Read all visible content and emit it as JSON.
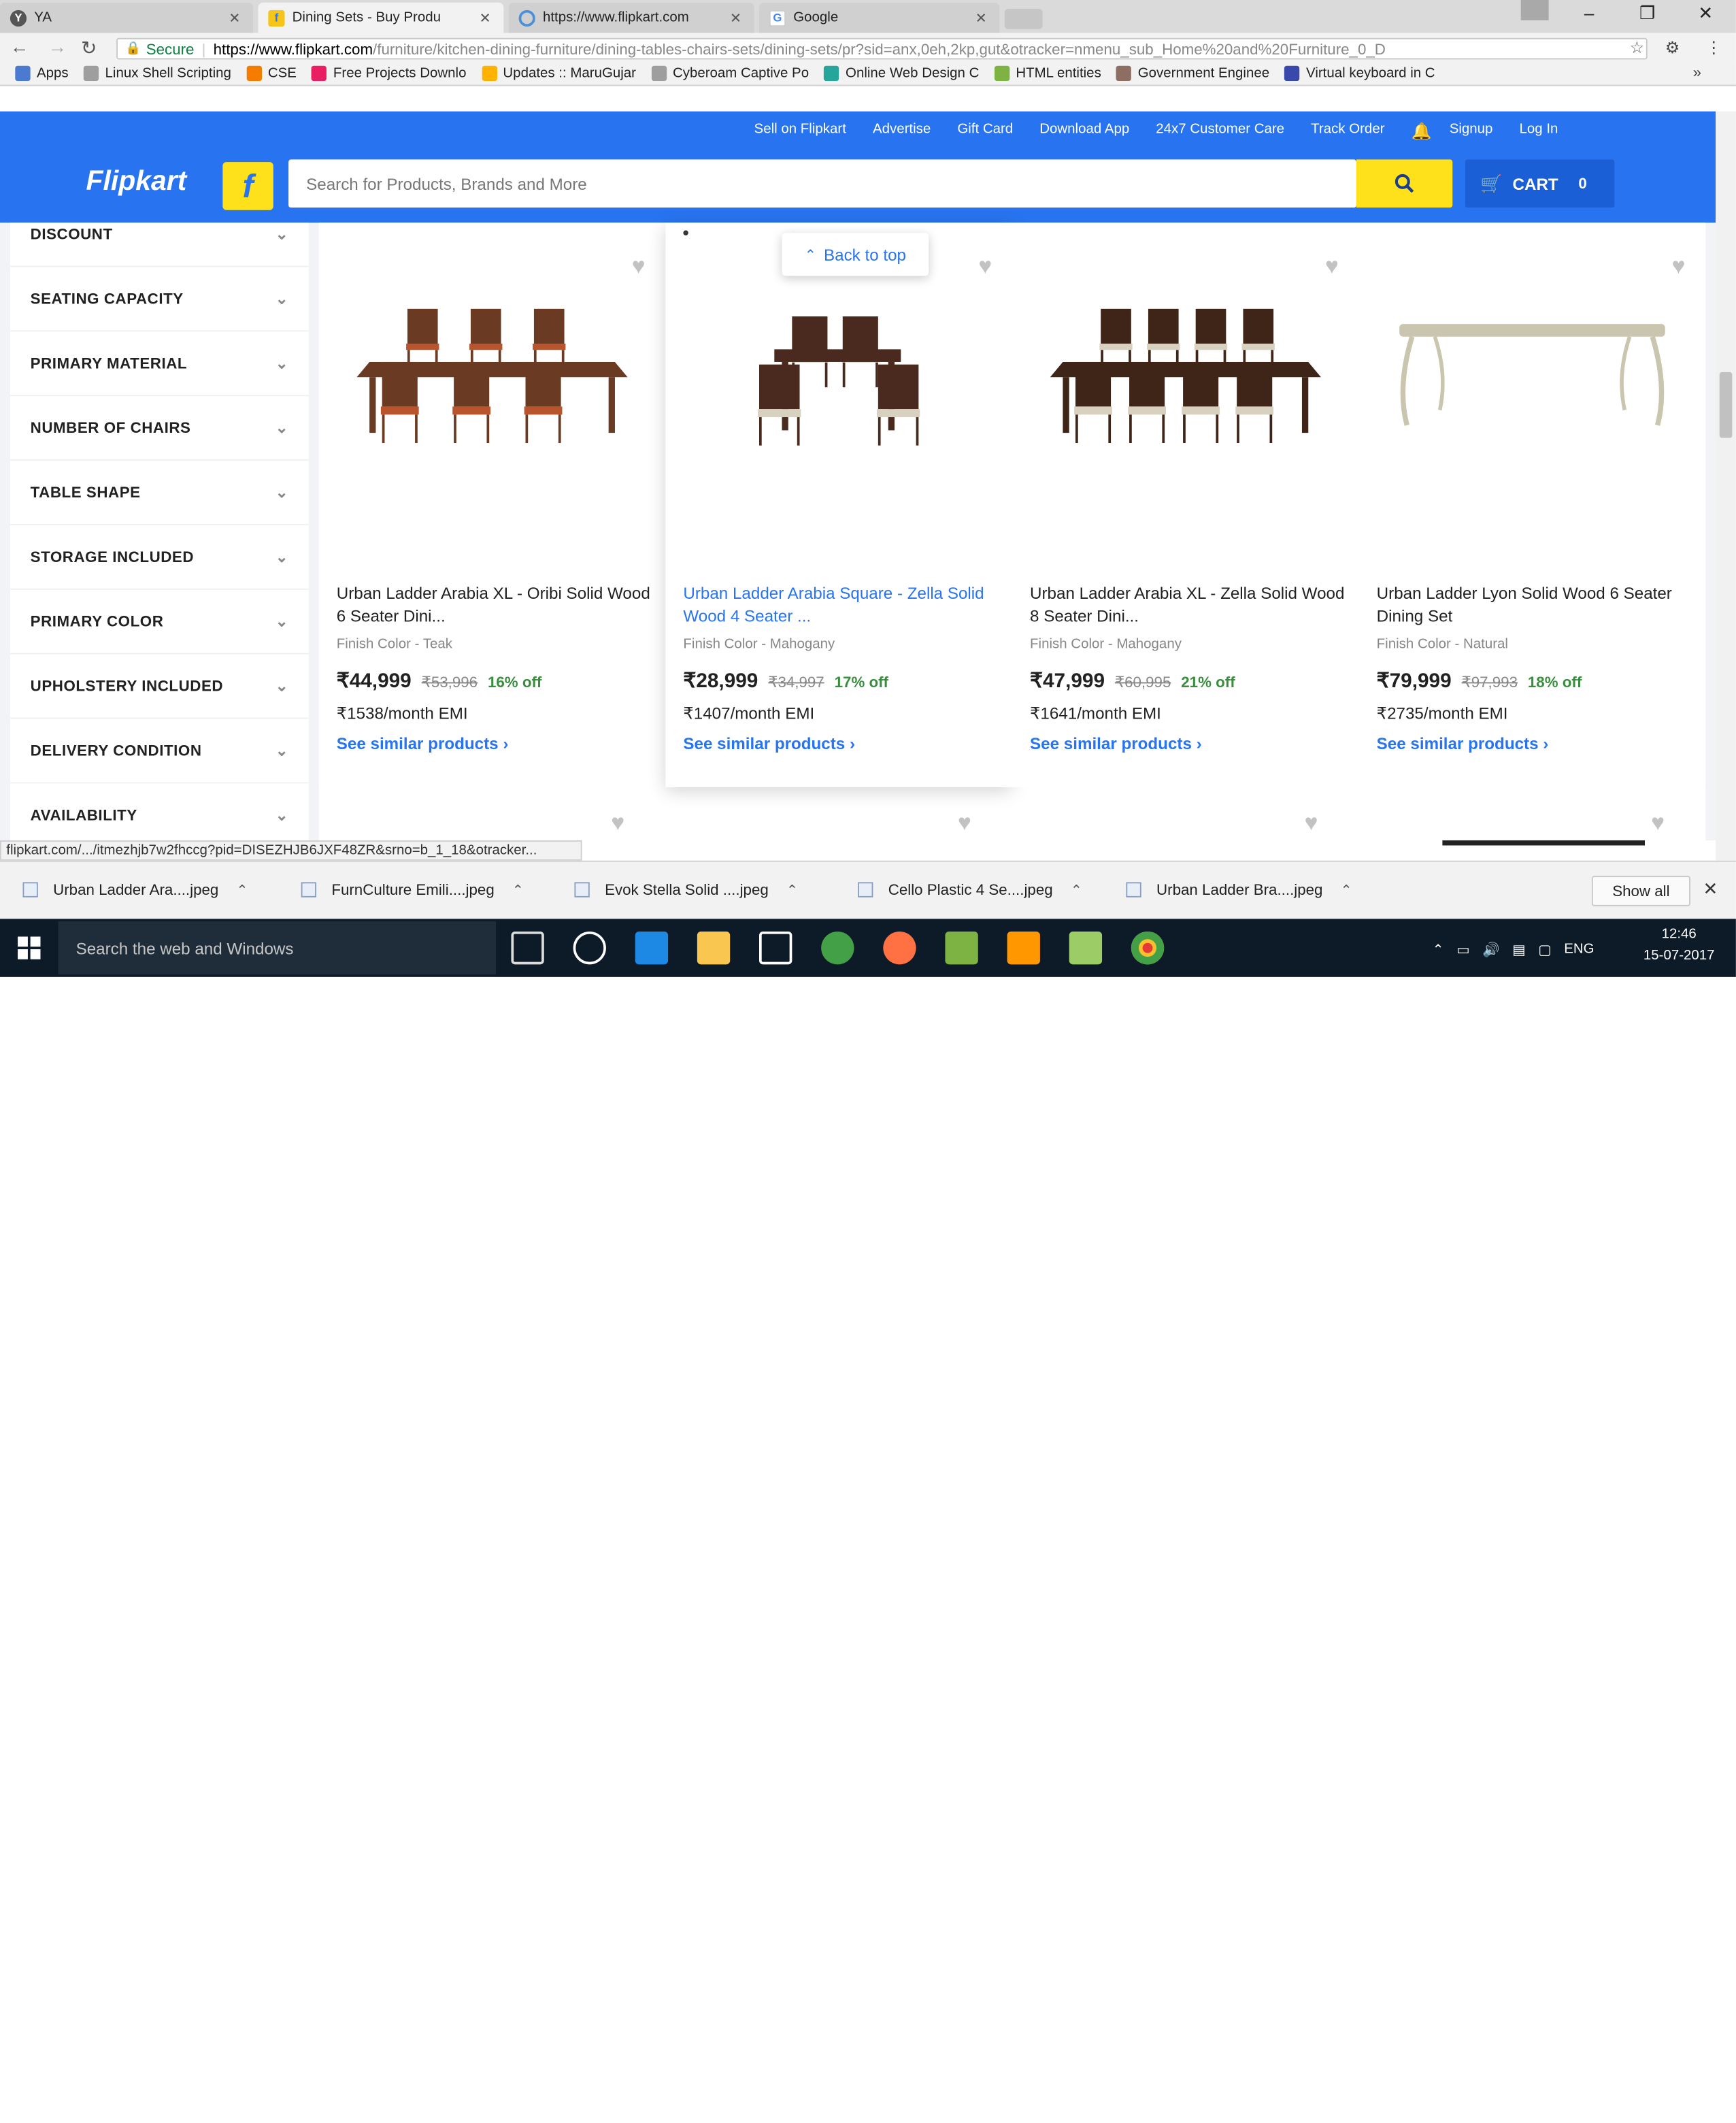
{
  "browser": {
    "tabs": [
      {
        "title": "YA",
        "favicon": "yahoo-answers-icon",
        "color": "#555555"
      },
      {
        "title": "Dining Sets - Buy Produ",
        "favicon": "flipkart-icon",
        "color": "#f5c518",
        "active": true
      },
      {
        "title": "https://www.flipkart.com",
        "favicon": "loading-icon",
        "color": "#4a90d9"
      },
      {
        "title": "Google",
        "favicon": "google-icon",
        "color": "#4285f4"
      }
    ],
    "secure_label": "Secure",
    "url_host": "https://www.flipkart.com",
    "url_path": "/furniture/kitchen-dining-furniture/dining-tables-chairs-sets/dining-sets/pr?sid=anx,0eh,2kp,gut&otracker=nmenu_sub_Home%20and%20Furniture_0_D",
    "bookmarks": [
      {
        "label": "Apps",
        "icon": "apps-grid-icon",
        "color": "#4a7bd0"
      },
      {
        "label": "Linux Shell Scripting",
        "icon": "page-icon",
        "color": "#9e9e9e"
      },
      {
        "label": "CSE",
        "icon": "blogger-icon",
        "color": "#f57c00"
      },
      {
        "label": "Free Projects Downlo",
        "icon": "fp-icon",
        "color": "#e91e63"
      },
      {
        "label": "Updates :: MaruGujar",
        "icon": "sun-icon",
        "color": "#ffb300"
      },
      {
        "label": "Cyberoam Captive Po",
        "icon": "page-icon",
        "color": "#9e9e9e"
      },
      {
        "label": "Online Web Design C",
        "icon": "globe-icon",
        "color": "#26a69a"
      },
      {
        "label": "HTML entities",
        "icon": "html-icon",
        "color": "#7cb342"
      },
      {
        "label": "Government Enginee",
        "icon": "gov-icon",
        "color": "#8d6e63"
      },
      {
        "label": "Virtual keyboard in C",
        "icon": "keyboard-icon",
        "color": "#3949ab"
      }
    ]
  },
  "header": {
    "links": [
      "Sell on Flipkart",
      "Advertise",
      "Gift Card",
      "Download App",
      "24x7 Customer Care",
      "Track Order",
      "Signup",
      "Log In"
    ],
    "logo": "Flipkart",
    "search_placeholder": "Search for Products, Brands and More",
    "cart_label": "CART",
    "cart_count": "0",
    "brand_color": "#2874f0",
    "accent_color": "#ffe11b"
  },
  "filters": [
    "DISCOUNT",
    "SEATING CAPACITY",
    "PRIMARY MATERIAL",
    "NUMBER OF CHAIRS",
    "TABLE SHAPE",
    "STORAGE INCLUDED",
    "PRIMARY COLOR",
    "UPHOLSTERY INCLUDED",
    "DELIVERY CONDITION",
    "AVAILABILITY"
  ],
  "back_to_top": "Back to top",
  "products": [
    {
      "title": "Urban Ladder Arabia XL - Oribi Solid Wood 6 Seater Dini...",
      "finish": "Finish Color - Teak",
      "price": "₹44,999",
      "mrp": "₹53,996",
      "off": "16% off",
      "emi": "₹1538/month EMI",
      "similar": "See similar products ›",
      "image": "six-seater-dining-set",
      "wood_color": "#6b3a22",
      "seat_color": "#b8552d"
    },
    {
      "title": "Urban Ladder Arabia Square - Zella Solid Wood 4 Seater ...",
      "finish": "Finish Color - Mahogany",
      "price": "₹28,999",
      "mrp": "₹34,997",
      "off": "17% off",
      "emi": "₹1407/month EMI",
      "similar": "See similar products ›",
      "image": "four-seater-dining-set",
      "wood_color": "#4a2a1e",
      "seat_color": "#d9d1c0",
      "highlighted": true
    },
    {
      "title": "Urban Ladder Arabia XL - Zella Solid Wood 8 Seater Dini...",
      "finish": "Finish Color - Mahogany",
      "price": "₹47,999",
      "mrp": "₹60,995",
      "off": "21% off",
      "emi": "₹1641/month EMI",
      "similar": "See similar products ›",
      "image": "eight-seater-dining-set",
      "wood_color": "#3f2418",
      "seat_color": "#d9d1c0"
    },
    {
      "title": "Urban Ladder Lyon Solid Wood 6 Seater Dining Set",
      "finish": "Finish Color - Natural",
      "price": "₹79,999",
      "mrp": "₹97,993",
      "off": "18% off",
      "emi": "₹2735/month EMI",
      "similar": "See similar products ›",
      "image": "lyon-dining-table",
      "wood_color": "#c9c5ae",
      "seat_color": "#b5b09a"
    }
  ],
  "status_url": "flipkart.com/.../itmezhjb7w2fhccg?pid=DISEZHJB6JXF48ZR&srno=b_1_18&otracker...",
  "downloads": [
    "Urban Ladder Ara....jpeg",
    "FurnCulture Emili....jpeg",
    "Evok Stella Solid ....jpeg",
    "Cello Plastic 4 Se....jpeg",
    "Urban Ladder Bra....jpeg"
  ],
  "show_all": "Show all",
  "taskbar": {
    "search_placeholder": "Search the web and Windows",
    "apps": [
      {
        "name": "task-view-icon",
        "color": "#0d1a28"
      },
      {
        "name": "hp-icon",
        "color": "#0d1a28"
      },
      {
        "name": "edge-icon",
        "color": "#1e88e5"
      },
      {
        "name": "file-explorer-icon",
        "color": "#f9c74f"
      },
      {
        "name": "store-icon",
        "color": "#0d1a28"
      },
      {
        "name": "chrome-old-icon",
        "color": "#43a047"
      },
      {
        "name": "firefox-icon",
        "color": "#ff7043"
      },
      {
        "name": "app-icon",
        "color": "#7cb342"
      },
      {
        "name": "vlc-icon",
        "color": "#ff9800"
      },
      {
        "name": "notepad-icon",
        "color": "#9ccc65"
      },
      {
        "name": "chrome-icon",
        "color": "#e53935"
      }
    ],
    "language": "ENG",
    "time": "12:46",
    "date": "15-07-2017"
  }
}
